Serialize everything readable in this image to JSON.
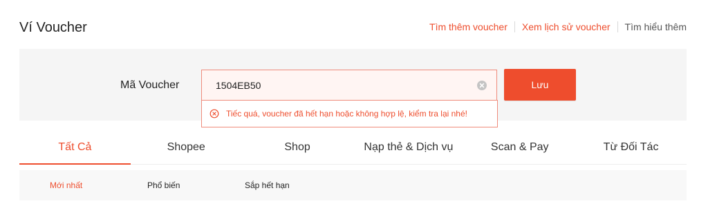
{
  "header": {
    "title": "Ví Voucher",
    "links": [
      "Tìm thêm voucher",
      "Xem lịch sử voucher",
      "Tìm hiểu thêm"
    ]
  },
  "redeem": {
    "label": "Mã Voucher",
    "code_value": "1504EB50",
    "save_label": "Lưu",
    "error_text": "Tiếc quá, voucher đã hết hạn hoặc không hợp lệ, kiểm tra lại nhé!",
    "clear_icon": "clear-circle-icon",
    "error_icon": "error-circle-icon"
  },
  "tabs": [
    "Tất Cả",
    "Shopee",
    "Shop",
    "Nạp thẻ & Dịch vụ",
    "Scan & Pay",
    "Từ Đối Tác"
  ],
  "active_tab": "Tất Cả",
  "subfilters": [
    "Mới nhất",
    "Phổ biến",
    "Sắp hết hạn"
  ],
  "active_subfilter": "Mới nhất",
  "colors": {
    "accent": "#ee4d2d",
    "error_border": "#ef8a7a",
    "panel_bg": "#f5f5f5"
  }
}
